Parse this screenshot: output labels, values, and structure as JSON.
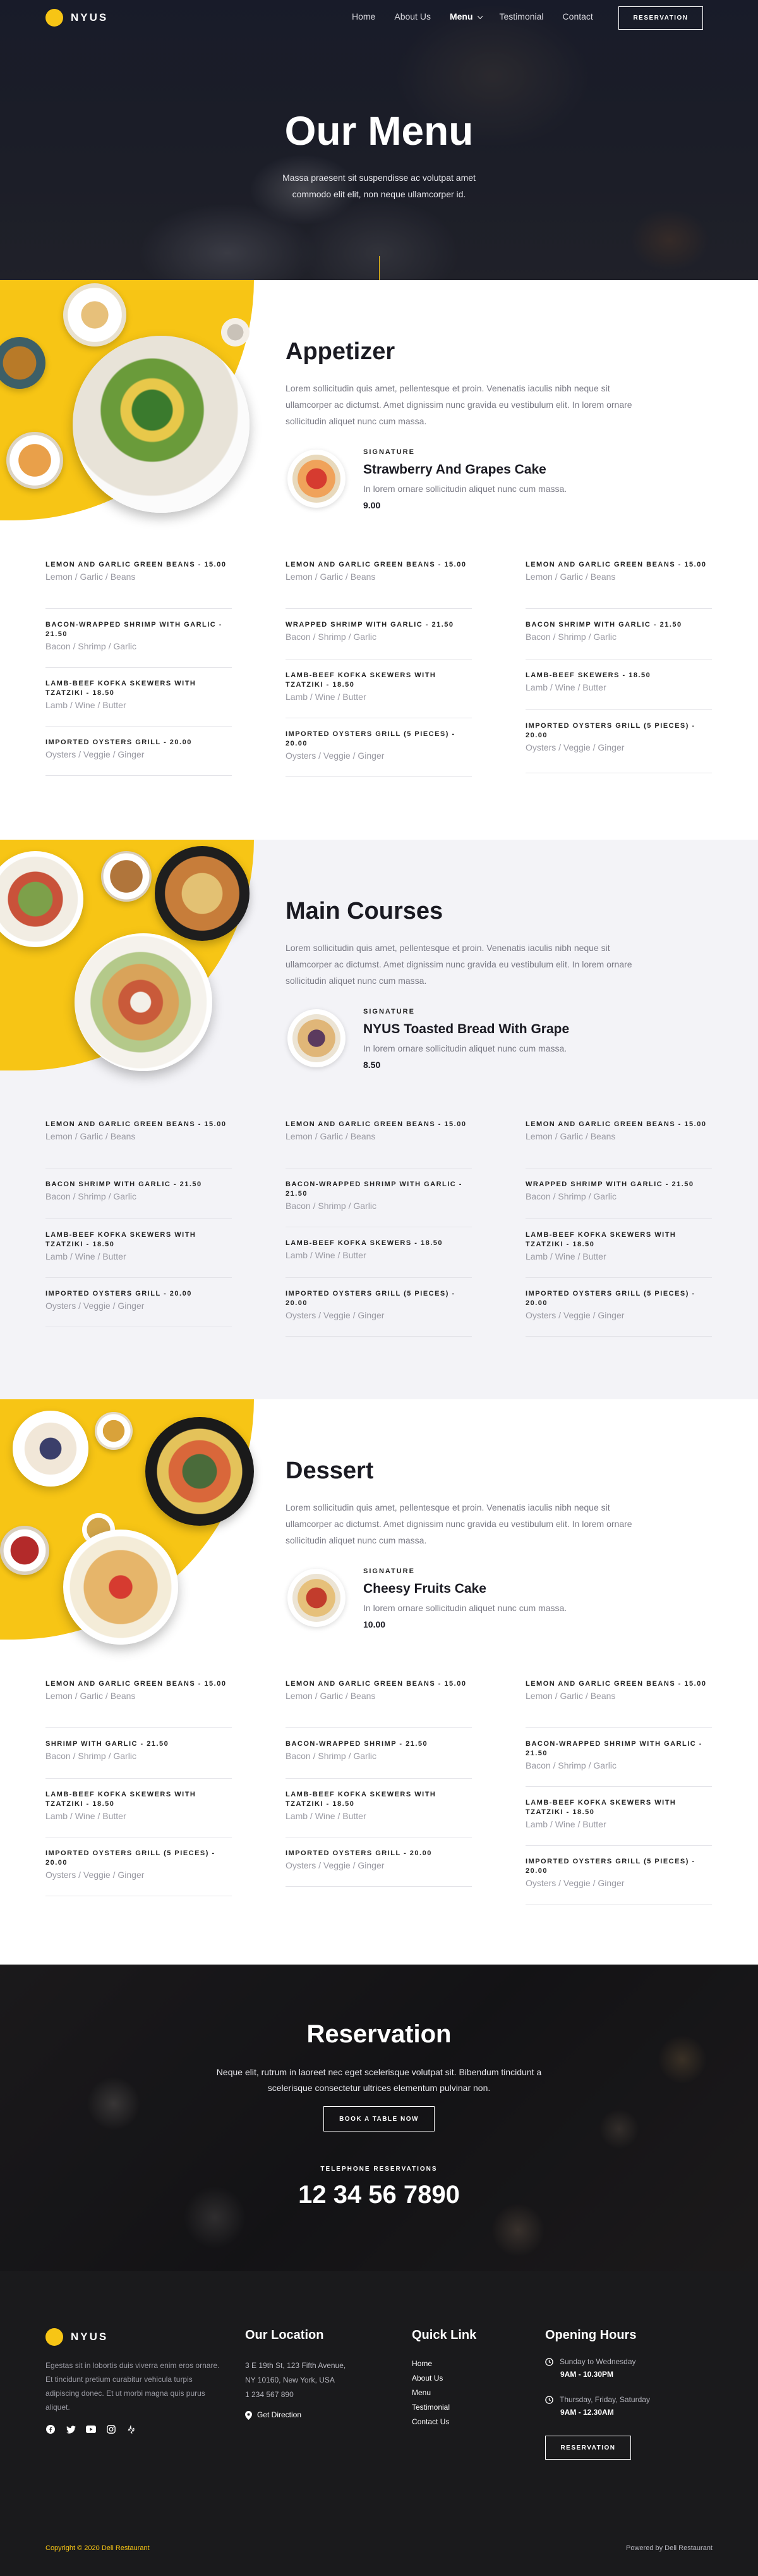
{
  "brand": {
    "name": "NYUS",
    "accent": "#f7c515"
  },
  "nav": {
    "links": [
      "Home",
      "About Us",
      "Menu",
      "Testimonial",
      "Contact"
    ],
    "active": "Menu",
    "button": "RESERVATION"
  },
  "hero": {
    "title": "Our Menu",
    "subtitle": "Massa praesent sit suspendisse ac volutpat amet commodo elit elit, non neque ullamcorper id."
  },
  "sections": [
    {
      "title": "Appetizer",
      "desc": "Lorem sollicitudin quis amet, pellentesque et proin. Venenatis iaculis nibh neque sit ullamcorper ac dictumst. Amet dignissim nunc gravida eu vestibulum elit. In lorem ornare sollicitudin aliquet nunc cum massa.",
      "signature": {
        "label": "SIGNATURE",
        "name": "Strawberry And Grapes Cake",
        "desc": "In lorem ornare sollicitudin aliquet nunc cum massa.",
        "price": "9.00"
      },
      "columns": [
        [
          {
            "name": "LEMON AND GARLIC GREEN BEANS - 15.00",
            "ing": "Lemon / Garlic / Beans"
          },
          {
            "name": "BACON-WRAPPED SHRIMP WITH GARLIC - 21.50",
            "ing": "Bacon / Shrimp / Garlic"
          },
          {
            "name": "LAMB-BEEF KOFKA SKEWERS WITH TZATZIKI - 18.50",
            "ing": "Lamb / Wine / Butter"
          },
          {
            "name": "IMPORTED OYSTERS GRILL - 20.00",
            "ing": "Oysters / Veggie / Ginger"
          }
        ],
        [
          {
            "name": "LEMON AND GARLIC GREEN BEANS - 15.00",
            "ing": "Lemon / Garlic / Beans"
          },
          {
            "name": "WRAPPED SHRIMP WITH GARLIC - 21.50",
            "ing": "Bacon / Shrimp / Garlic"
          },
          {
            "name": "LAMB-BEEF KOFKA SKEWERS WITH TZATZIKI - 18.50",
            "ing": "Lamb / Wine / Butter"
          },
          {
            "name": "IMPORTED OYSTERS GRILL (5 PIECES) - 20.00",
            "ing": "Oysters / Veggie / Ginger"
          }
        ],
        [
          {
            "name": "LEMON AND GARLIC GREEN BEANS - 15.00",
            "ing": "Lemon / Garlic / Beans"
          },
          {
            "name": "BACON SHRIMP WITH GARLIC - 21.50",
            "ing": "Bacon / Shrimp / Garlic"
          },
          {
            "name": "LAMB-BEEF SKEWERS - 18.50",
            "ing": "Lamb / Wine / Butter"
          },
          {
            "name": "IMPORTED OYSTERS GRILL (5 PIECES) - 20.00",
            "ing": "Oysters / Veggie / Ginger"
          }
        ]
      ]
    },
    {
      "title": "Main Courses",
      "desc": "Lorem sollicitudin quis amet, pellentesque et proin. Venenatis iaculis nibh neque sit ullamcorper ac dictumst. Amet dignissim nunc gravida eu vestibulum elit. In lorem ornare sollicitudin aliquet nunc cum massa.",
      "signature": {
        "label": "SIGNATURE",
        "name": "NYUS Toasted Bread With Grape",
        "desc": "In lorem ornare sollicitudin aliquet nunc cum massa.",
        "price": "8.50"
      },
      "columns": [
        [
          {
            "name": "LEMON AND GARLIC GREEN BEANS - 15.00",
            "ing": "Lemon / Garlic / Beans"
          },
          {
            "name": "BACON SHRIMP WITH GARLIC - 21.50",
            "ing": "Bacon / Shrimp / Garlic"
          },
          {
            "name": "LAMB-BEEF KOFKA SKEWERS WITH TZATZIKI - 18.50",
            "ing": "Lamb / Wine / Butter"
          },
          {
            "name": "IMPORTED OYSTERS GRILL - 20.00",
            "ing": "Oysters / Veggie / Ginger"
          }
        ],
        [
          {
            "name": "LEMON AND GARLIC GREEN BEANS - 15.00",
            "ing": "Lemon / Garlic / Beans"
          },
          {
            "name": "BACON-WRAPPED SHRIMP WITH GARLIC - 21.50",
            "ing": "Bacon / Shrimp / Garlic"
          },
          {
            "name": "LAMB-BEEF KOFKA SKEWERS - 18.50",
            "ing": "Lamb / Wine / Butter"
          },
          {
            "name": "IMPORTED OYSTERS GRILL (5 PIECES) - 20.00",
            "ing": "Oysters / Veggie / Ginger"
          }
        ],
        [
          {
            "name": "LEMON AND GARLIC GREEN BEANS - 15.00",
            "ing": "Lemon / Garlic / Beans"
          },
          {
            "name": "WRAPPED SHRIMP WITH GARLIC - 21.50",
            "ing": "Bacon / Shrimp / Garlic"
          },
          {
            "name": "LAMB-BEEF KOFKA SKEWERS WITH TZATZIKI - 18.50",
            "ing": "Lamb / Wine / Butter"
          },
          {
            "name": "IMPORTED OYSTERS GRILL (5 PIECES) - 20.00",
            "ing": "Oysters / Veggie / Ginger"
          }
        ]
      ]
    },
    {
      "title": "Dessert",
      "desc": "Lorem sollicitudin quis amet, pellentesque et proin. Venenatis iaculis nibh neque sit ullamcorper ac dictumst. Amet dignissim nunc gravida eu vestibulum elit. In lorem ornare sollicitudin aliquet nunc cum massa.",
      "signature": {
        "label": "SIGNATURE",
        "name": "Cheesy Fruits Cake",
        "desc": "In lorem ornare sollicitudin aliquet nunc cum massa.",
        "price": "10.00"
      },
      "columns": [
        [
          {
            "name": "LEMON AND GARLIC GREEN BEANS - 15.00",
            "ing": "Lemon / Garlic / Beans"
          },
          {
            "name": "SHRIMP WITH GARLIC - 21.50",
            "ing": "Bacon / Shrimp / Garlic"
          },
          {
            "name": "LAMB-BEEF KOFKA SKEWERS WITH TZATZIKI - 18.50",
            "ing": "Lamb / Wine / Butter"
          },
          {
            "name": "IMPORTED OYSTERS GRILL (5 PIECES) - 20.00",
            "ing": "Oysters / Veggie / Ginger"
          }
        ],
        [
          {
            "name": "LEMON AND GARLIC GREEN BEANS - 15.00",
            "ing": "Lemon / Garlic / Beans"
          },
          {
            "name": "BACON-WRAPPED SHRIMP - 21.50",
            "ing": "Bacon / Shrimp / Garlic"
          },
          {
            "name": "LAMB-BEEF KOFKA SKEWERS WITH TZATZIKI - 18.50",
            "ing": "Lamb / Wine / Butter"
          },
          {
            "name": "IMPORTED OYSTERS GRILL - 20.00",
            "ing": "Oysters / Veggie / Ginger"
          }
        ],
        [
          {
            "name": "LEMON AND GARLIC GREEN BEANS - 15.00",
            "ing": "Lemon / Garlic / Beans"
          },
          {
            "name": "BACON-WRAPPED SHRIMP WITH GARLIC - 21.50",
            "ing": "Bacon / Shrimp / Garlic"
          },
          {
            "name": "LAMB-BEEF KOFKA SKEWERS WITH TZATZIKI - 18.50",
            "ing": "Lamb / Wine / Butter"
          },
          {
            "name": "IMPORTED OYSTERS GRILL (5 PIECES) - 20.00",
            "ing": "Oysters / Veggie / Ginger"
          }
        ]
      ]
    }
  ],
  "reservation": {
    "title": "Reservation",
    "subtitle": "Neque elit, rutrum in laoreet nec eget scelerisque volutpat sit. Bibendum tincidunt a scelerisque consectetur ultrices elementum pulvinar non.",
    "button": "BOOK A TABLE NOW",
    "tel_label": "TELEPHONE RESERVATIONS",
    "tel": "12 34 56 7890"
  },
  "footer": {
    "about": "Egestas sit in lobortis duis viverra enim eros ornare. Et tincidunt pretium curabitur vehicula turpis adipiscing donec. Et ut morbi magna quis purus aliquet.",
    "social_icons": [
      "facebook-icon",
      "twitter-icon",
      "youtube-icon",
      "instagram-icon",
      "yelp-icon"
    ],
    "location": {
      "title": "Our Location",
      "line1": "3 E 19th St, 123 Fifth Avenue,",
      "line2": "NY 10160, New York, USA",
      "phone": "1 234 567 890",
      "direction": "Get Direction"
    },
    "quick": {
      "title": "Quick Link",
      "links": [
        "Home",
        "About Us",
        "Menu",
        "Testimonial",
        "Contact Us"
      ]
    },
    "hours": {
      "title": "Opening Hours",
      "d1": "Sunday to Wednesday",
      "t1": "9AM - 10.30PM",
      "d2": "Thursday, Friday, Saturday",
      "t2": "9AM - 12.30AM",
      "button": "RESERVATION"
    },
    "copyright": "Copyright © 2020 Deli Restaurant",
    "powered": "Powered by Deli Restaurant"
  }
}
